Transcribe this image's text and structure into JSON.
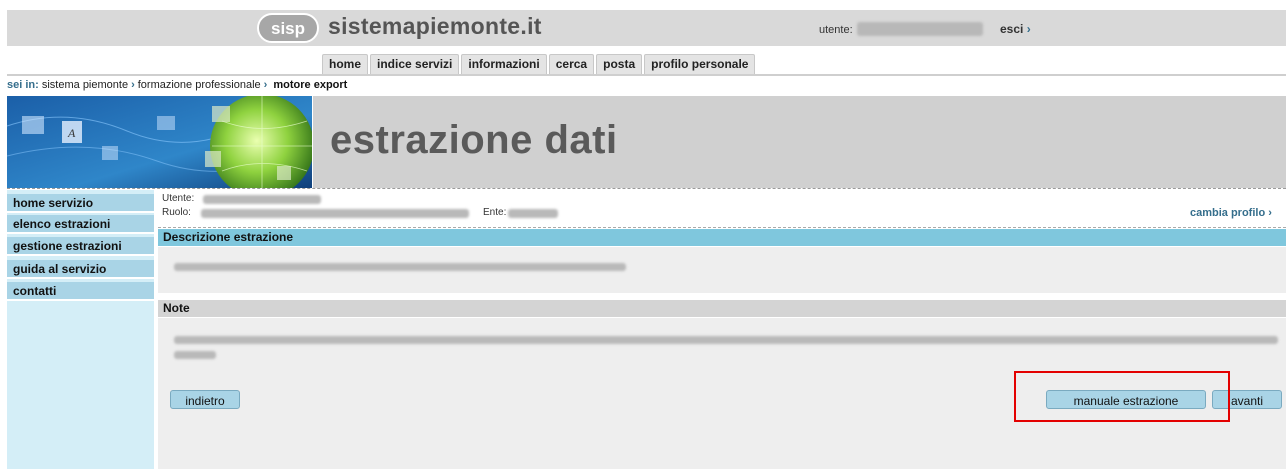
{
  "header": {
    "logo_text": "sisp",
    "site_title": "sistemapiemonte.it",
    "user_label": "utente:",
    "user_value": "",
    "logout_label": "esci",
    "chevron": ">"
  },
  "top_nav": [
    {
      "label": "home"
    },
    {
      "label": "indice servizi"
    },
    {
      "label": "informazioni"
    },
    {
      "label": "cerca"
    },
    {
      "label": "posta"
    },
    {
      "label": "profilo personale"
    }
  ],
  "breadcrumb": {
    "prefix": "sei in:",
    "items": [
      "sistema piemonte",
      "formazione professionale"
    ],
    "current": "motore export"
  },
  "banner": {
    "title": "estrazione dati"
  },
  "sidebar": {
    "items": [
      {
        "label": "home servizio"
      },
      {
        "label": "elenco estrazioni"
      },
      {
        "label": "gestione estrazioni"
      },
      {
        "label": "guida al servizio"
      },
      {
        "label": "contatti"
      }
    ]
  },
  "profile": {
    "user_label": "Utente:",
    "role_label": "Ruolo:",
    "entity_label": "Ente:",
    "change_profile": "cambia profilo"
  },
  "sections": {
    "description_title": "Descrizione estrazione",
    "notes_title": "Note"
  },
  "buttons": {
    "back": "indietro",
    "manual": "manuale estrazione",
    "next": "avanti"
  },
  "colors": {
    "accent_blue": "#7fc7dd",
    "button_blue": "#a9d4e6",
    "highlight_red": "#e30000"
  }
}
